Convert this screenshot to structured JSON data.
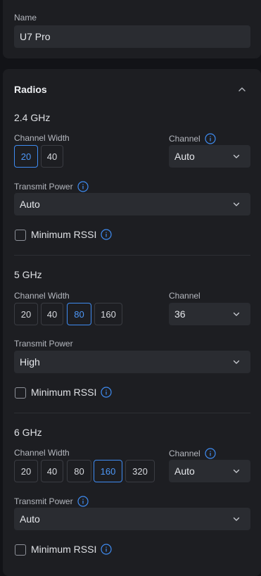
{
  "name_section": {
    "label": "Name",
    "value": "U7 Pro"
  },
  "radios": {
    "title": "Radios",
    "bands": [
      {
        "title": "2.4 GHz",
        "channel_width_label": "Channel Width",
        "widths": [
          "20",
          "40"
        ],
        "selected_width": "20",
        "channel_label": "Channel",
        "channel_value": "Auto",
        "transmit_power_label": "Transmit Power",
        "transmit_power_value": "Auto",
        "min_rssi_label": "Minimum RSSI"
      },
      {
        "title": "5 GHz",
        "channel_width_label": "Channel Width",
        "widths": [
          "20",
          "40",
          "80",
          "160"
        ],
        "selected_width": "80",
        "channel_label": "Channel",
        "channel_value": "36",
        "transmit_power_label": "Transmit Power",
        "transmit_power_value": "High",
        "min_rssi_label": "Minimum RSSI"
      },
      {
        "title": "6 GHz",
        "channel_width_label": "Channel Width",
        "widths": [
          "20",
          "40",
          "80",
          "160",
          "320"
        ],
        "selected_width": "160",
        "channel_label": "Channel",
        "channel_value": "Auto",
        "transmit_power_label": "Transmit Power",
        "transmit_power_value": "Auto",
        "min_rssi_label": "Minimum RSSI"
      }
    ]
  },
  "colors": {
    "accent": "#3f8cf2",
    "panel": "#1d1e22",
    "field": "#2a2c31",
    "background": "#121317"
  },
  "icons": {
    "info": "info-icon",
    "chevron": "chevron-down-icon",
    "collapse": "chevron-up-icon"
  }
}
